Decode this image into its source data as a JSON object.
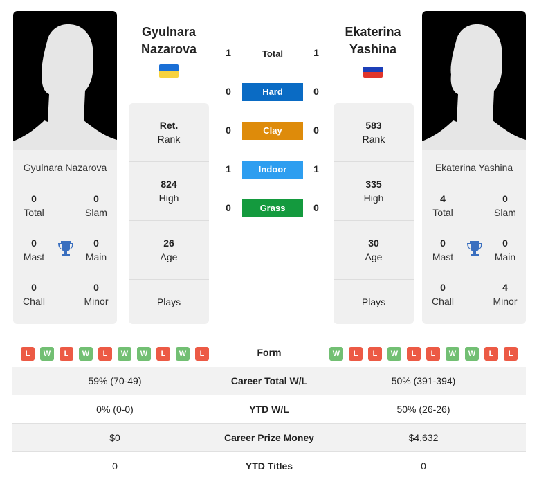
{
  "players": [
    {
      "name": "Gyulnara Nazarova",
      "name_line1": "Gyulnara",
      "name_line2": "Nazarova",
      "flag": "ukraine",
      "flag_colors": [
        "#1a6fd6",
        "#f7d23e"
      ],
      "titles": {
        "total": "0",
        "slam": "0",
        "mast": "0",
        "main": "0",
        "chall": "0",
        "minor": "0"
      },
      "rank": {
        "value": "Ret.",
        "label": "Rank"
      },
      "high": {
        "value": "824",
        "label": "High"
      },
      "age": {
        "value": "26",
        "label": "Age"
      },
      "plays": {
        "value": "",
        "label": "Plays"
      },
      "form": [
        "L",
        "W",
        "L",
        "W",
        "L",
        "W",
        "W",
        "L",
        "W",
        "L"
      ]
    },
    {
      "name": "Ekaterina Yashina",
      "name_line1": "Ekaterina",
      "name_line2": "Yashina",
      "flag": "russia",
      "flag_colors": [
        "#ffffff",
        "#1c3fb8",
        "#e0352b"
      ],
      "titles": {
        "total": "4",
        "slam": "0",
        "mast": "0",
        "main": "0",
        "chall": "0",
        "minor": "4"
      },
      "rank": {
        "value": "583",
        "label": "Rank"
      },
      "high": {
        "value": "335",
        "label": "High"
      },
      "age": {
        "value": "30",
        "label": "Age"
      },
      "plays": {
        "value": "",
        "label": "Plays"
      },
      "form": [
        "W",
        "L",
        "L",
        "W",
        "L",
        "L",
        "W",
        "W",
        "L",
        "L"
      ]
    }
  ],
  "title_labels": {
    "total": "Total",
    "slam": "Slam",
    "mast": "Mast",
    "main": "Main",
    "chall": "Chall",
    "minor": "Minor"
  },
  "h2h": [
    {
      "label": "Total",
      "left": "1",
      "right": "1",
      "color": null
    },
    {
      "label": "Hard",
      "left": "0",
      "right": "0",
      "color": "#0a6bc4"
    },
    {
      "label": "Clay",
      "left": "0",
      "right": "0",
      "color": "#de8b0a"
    },
    {
      "label": "Indoor",
      "left": "1",
      "right": "1",
      "color": "#2e9ef0"
    },
    {
      "label": "Grass",
      "left": "0",
      "right": "0",
      "color": "#149a3e"
    }
  ],
  "form_label": "Form",
  "form_colors": {
    "W": "#72bf73",
    "L": "#ec5a45"
  },
  "stats": [
    {
      "label": "Career Total W/L",
      "left": "59% (70-49)",
      "right": "50% (391-394)"
    },
    {
      "label": "YTD W/L",
      "left": "0% (0-0)",
      "right": "50% (26-26)"
    },
    {
      "label": "Career Prize Money",
      "left": "$0",
      "right": "$4,632"
    },
    {
      "label": "YTD Titles",
      "left": "0",
      "right": "0"
    }
  ]
}
